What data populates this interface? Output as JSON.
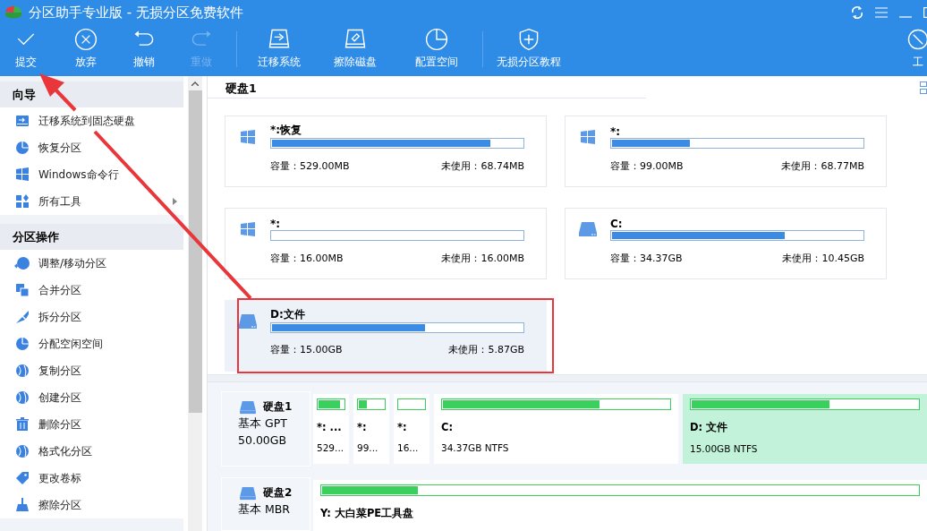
{
  "window": {
    "title": "分区助手专业版 - 无损分区免费软件"
  },
  "toolbar": [
    {
      "label": "提交",
      "disabled": false
    },
    {
      "label": "放弃",
      "disabled": false
    },
    {
      "label": "撤销",
      "disabled": false
    },
    {
      "label": "重做",
      "disabled": true
    },
    {
      "label": "迁移系统",
      "disabled": false
    },
    {
      "label": "擦除磁盘",
      "disabled": false
    },
    {
      "label": "配置空间",
      "disabled": false
    },
    {
      "label": "无损分区教程",
      "disabled": false
    },
    {
      "label": "工",
      "disabled": false
    }
  ],
  "sidebar": [
    {
      "title": "向导",
      "items": [
        {
          "label": "迁移系统到固态硬盘",
          "arrow": false
        },
        {
          "label": "恢复分区",
          "arrow": false
        },
        {
          "label": "Windows命令行",
          "arrow": false
        },
        {
          "label": "所有工具",
          "arrow": true
        }
      ]
    },
    {
      "title": "分区操作",
      "items": [
        {
          "label": "调整/移动分区",
          "arrow": false
        },
        {
          "label": "合并分区",
          "arrow": false
        },
        {
          "label": "拆分分区",
          "arrow": false
        },
        {
          "label": "分配空闲空间",
          "arrow": false
        },
        {
          "label": "复制分区",
          "arrow": false
        },
        {
          "label": "创建分区",
          "arrow": false
        },
        {
          "label": "删除分区",
          "arrow": false
        },
        {
          "label": "格式化分区",
          "arrow": false
        },
        {
          "label": "更改卷标",
          "arrow": false
        },
        {
          "label": "擦除分区",
          "arrow": false
        }
      ]
    }
  ],
  "disk_view": {
    "title": "硬盘1",
    "partitions": [
      {
        "name": "*:恢复",
        "kind": "windows",
        "level": 0.87,
        "capacity": "容量：529.00MB",
        "unused": "未使用：68.74MB",
        "selected": false
      },
      {
        "name": "*:",
        "kind": "windows",
        "level": 0.31,
        "capacity": "容量：99.00MB",
        "unused": "未使用：68.77MB",
        "selected": false
      },
      {
        "name": "*:",
        "kind": "windows",
        "level": 0,
        "capacity": "容量：16.00MB",
        "unused": "未使用：16.00MB",
        "selected": false
      },
      {
        "name": "C:",
        "kind": "drive",
        "level": 0.69,
        "capacity": "容量：34.37GB",
        "unused": "未使用：10.45GB",
        "selected": false
      },
      {
        "name": "D:文件",
        "kind": "drive",
        "level": 0.61,
        "capacity": "容量：15.00GB",
        "unused": "未使用：5.87GB",
        "selected": true
      }
    ]
  },
  "disk_map": [
    {
      "name": "硬盘1",
      "type": "基本 GPT",
      "size": "50.00GB",
      "partitions": [
        {
          "name": "*: ...",
          "detail": "529...",
          "kind": "small",
          "level": 0.87,
          "selected": false
        },
        {
          "name": "*:",
          "detail": "99...",
          "kind": "small",
          "level": 0.31,
          "selected": false
        },
        {
          "name": "*:",
          "detail": "16...",
          "kind": "small",
          "level": 0,
          "selected": false
        },
        {
          "name": "C:",
          "detail": "34.37GB NTFS",
          "kind": "large",
          "level": 0.69,
          "selected": false
        },
        {
          "name": "D: 文件",
          "detail": "15.00GB NTFS",
          "kind": "large",
          "level": 0.61,
          "selected": true
        }
      ]
    },
    {
      "name": "硬盘2",
      "type": "基本 MBR",
      "partitions": [
        {
          "name": "Y: 大白菜PE工具盘",
          "kind": "large",
          "level": 0.16,
          "selected": false
        }
      ]
    }
  ]
}
